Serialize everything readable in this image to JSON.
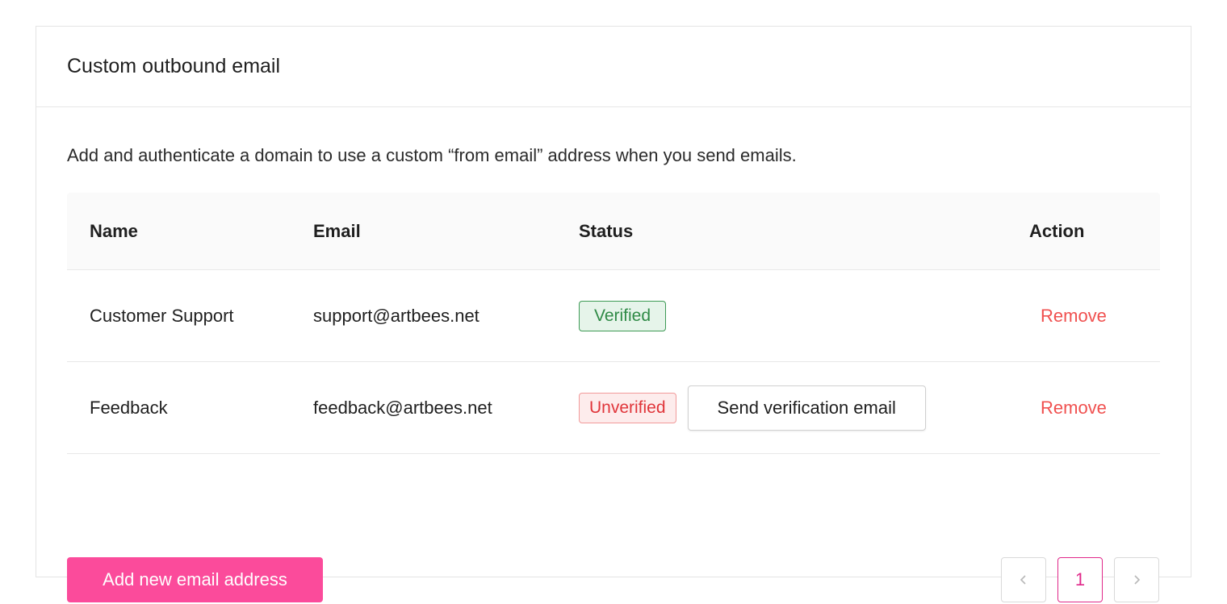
{
  "card": {
    "title": "Custom outbound email",
    "description": "Add and authenticate a domain to use a custom “from email” address when you send emails."
  },
  "table": {
    "headers": {
      "name": "Name",
      "email": "Email",
      "status": "Status",
      "action": "Action"
    },
    "rows": [
      {
        "name": "Customer Support",
        "email": "support@artbees.net",
        "status": "Verified",
        "action": "Remove"
      },
      {
        "name": "Feedback",
        "email": "feedback@artbees.net",
        "status": "Unverified",
        "secondary_action": "Send verification email",
        "action": "Remove"
      }
    ]
  },
  "footer": {
    "add_button": "Add new email address",
    "pagination": {
      "current_page": "1",
      "prev_icon": "chevron-left-icon",
      "next_icon": "chevron-right-icon"
    }
  },
  "colors": {
    "primary": "#fb4b9b",
    "verified": "#2f8a46",
    "unverified": "#e0353a",
    "remove_link": "#f0504f",
    "active_page": "#e0288a"
  }
}
